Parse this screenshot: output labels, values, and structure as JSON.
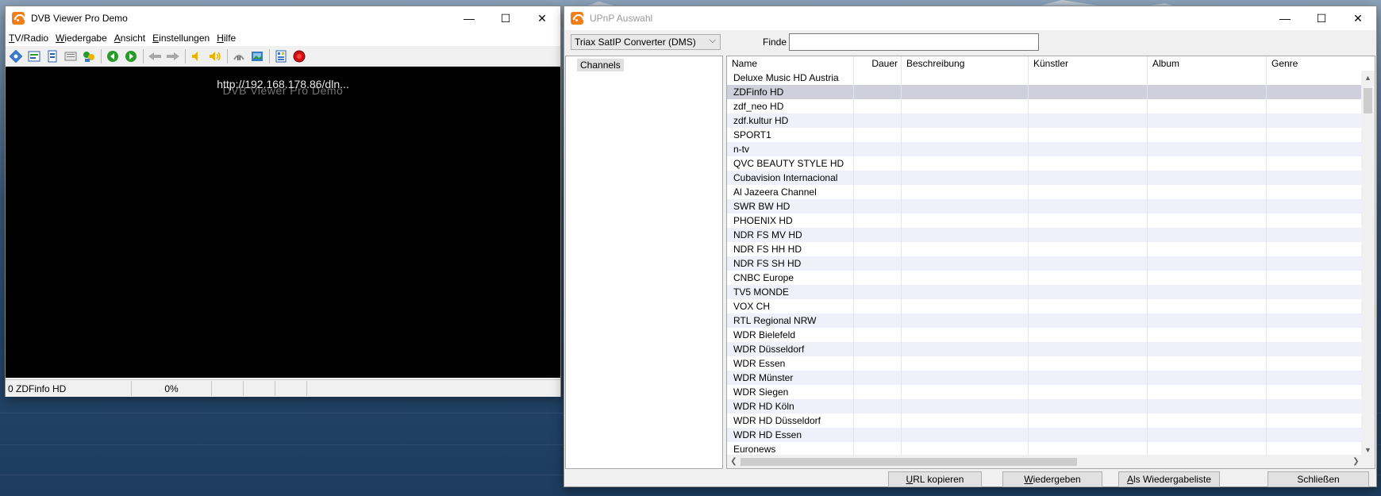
{
  "dvb": {
    "title": "DVB Viewer Pro Demo",
    "controls": {
      "minimize": "—",
      "maximize": "☐",
      "close": "✕"
    },
    "menu": [
      {
        "key": "T",
        "rest": "V/Radio"
      },
      {
        "key": "W",
        "rest": "iedergabe"
      },
      {
        "key": "A",
        "rest": "nsicht"
      },
      {
        "key": "E",
        "rest": "instellungen"
      },
      {
        "key": "H",
        "rest": "ilfe"
      }
    ],
    "toolbar_icons": [
      "channel-icon",
      "epg-icon",
      "recorder-icon",
      "teletext-icon",
      "favorites-icon",
      "back-icon",
      "forward-icon",
      "prev-channel-icon",
      "next-channel-icon",
      "volume-down-icon",
      "volume-up-icon",
      "pause-icon",
      "snapshot-icon",
      "options-icon",
      "record-icon"
    ],
    "osd_url": "http://192.168.178.86/dln...",
    "osd_ghost": "DVB Viewer Pro Demo",
    "status": {
      "channel": "0 ZDFinfo HD",
      "progress": "0%"
    }
  },
  "upnp": {
    "title": "UPnP Auswahl",
    "controls": {
      "minimize": "—",
      "maximize": "☐",
      "close": "✕"
    },
    "server_select": "Triax SatIP Converter (DMS)",
    "find_label": "Finde",
    "find_value": "",
    "tree_root": "Channels",
    "columns": [
      "Name",
      "Dauer",
      "Beschreibung",
      "Künstler",
      "Album",
      "Genre"
    ],
    "rows": [
      "Deluxe Music HD Austria",
      "ZDFinfo HD",
      "zdf_neo HD",
      "zdf.kultur HD",
      "SPORT1",
      "n-tv",
      "QVC BEAUTY   STYLE HD",
      "Cubavision Internacional",
      "Al Jazeera Channel",
      "SWR BW HD",
      "PHOENIX HD",
      "NDR FS MV HD",
      "NDR FS HH HD",
      "NDR FS SH HD",
      "CNBC Europe",
      "TV5 MONDE",
      "VOX CH",
      "RTL Regional NRW",
      "WDR Bielefeld",
      "WDR Düsseldorf",
      "WDR Essen",
      "WDR Münster",
      "WDR Siegen",
      "WDR HD Köln",
      "WDR HD Düsseldorf",
      "WDR HD Essen",
      "Euronews"
    ],
    "selected_index": 1,
    "buttons": {
      "copy_url": {
        "key": "U",
        "rest": "RL kopieren"
      },
      "play": {
        "key": "W",
        "rest": "iedergeben"
      },
      "playlist": {
        "key": "A",
        "rest": "ls Wiedergabeliste"
      },
      "close": {
        "label": "Schließen"
      }
    }
  },
  "colors": {
    "dvb_icon": "#f07e1b",
    "record_red": "#d01010",
    "accent_green": "#2a9a2a"
  }
}
